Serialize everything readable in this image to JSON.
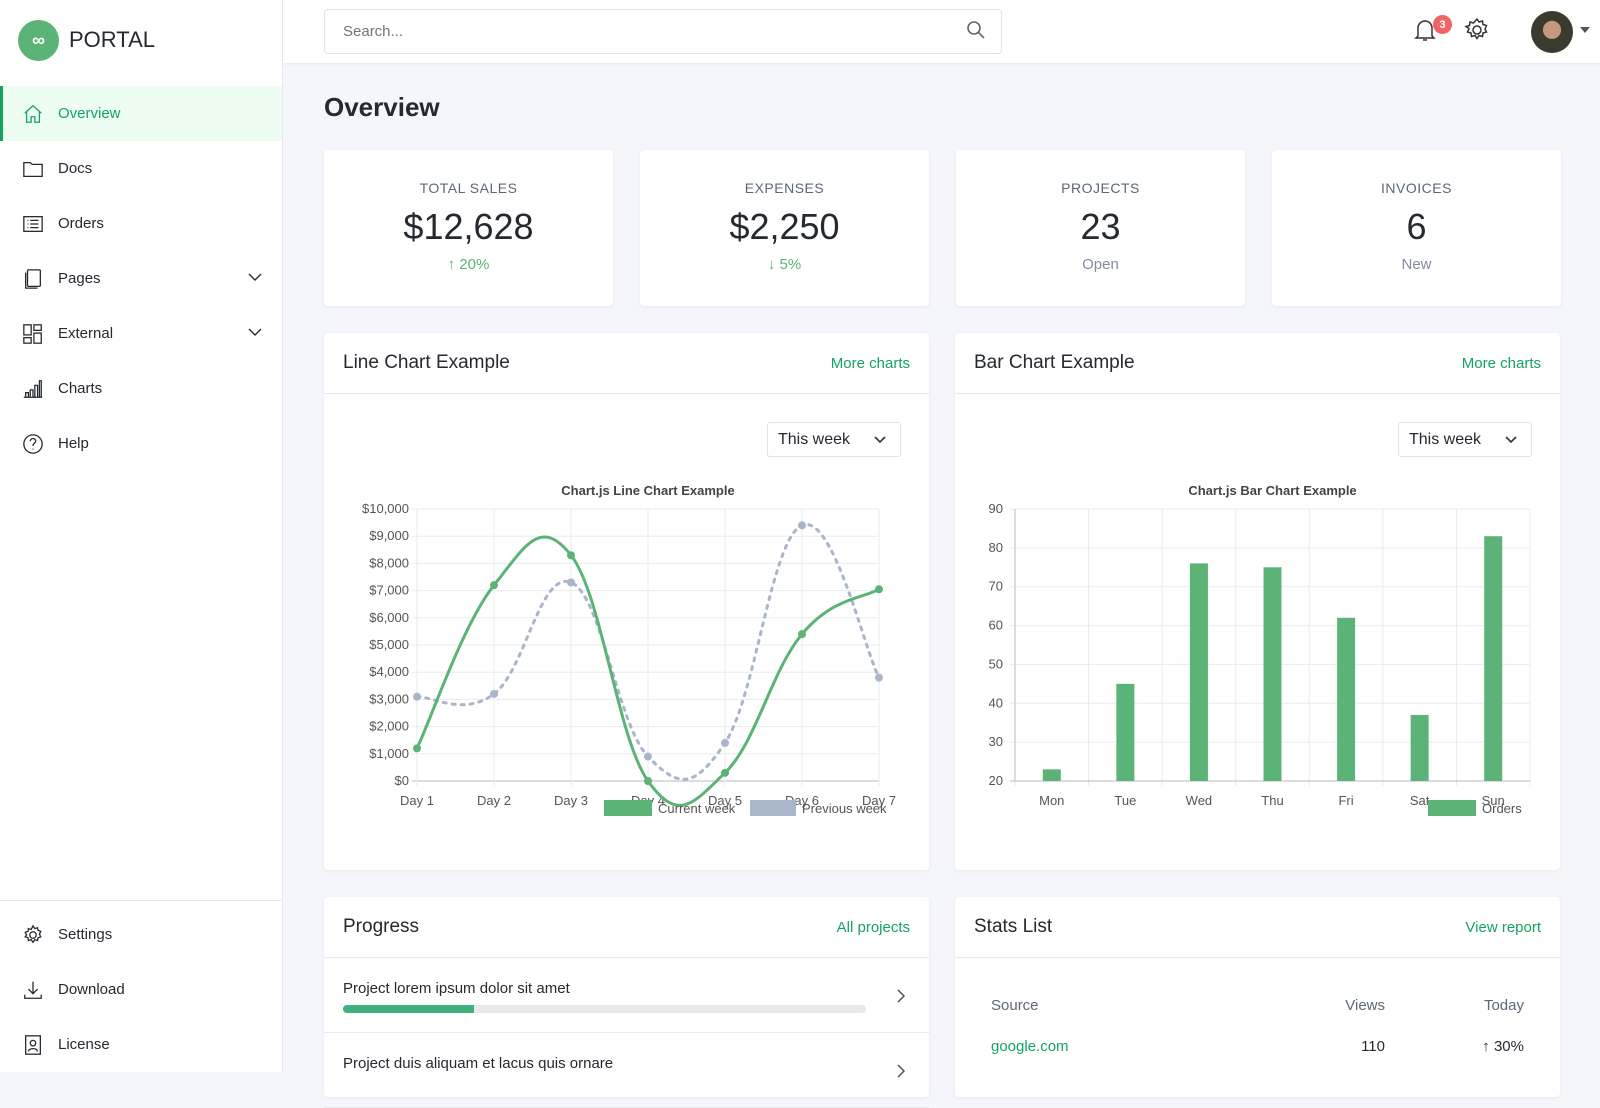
{
  "app": {
    "name": "PORTAL",
    "logo_glyph": "∞"
  },
  "sidebar": {
    "items": [
      {
        "label": "Overview",
        "icon": "home-icon",
        "active": true
      },
      {
        "label": "Docs",
        "icon": "folder-icon"
      },
      {
        "label": "Orders",
        "icon": "list-icon"
      },
      {
        "label": "Pages",
        "icon": "pages-icon",
        "expandable": true
      },
      {
        "label": "External",
        "icon": "grid-icon",
        "expandable": true
      },
      {
        "label": "Charts",
        "icon": "bar-chart-icon"
      },
      {
        "label": "Help",
        "icon": "help-icon"
      }
    ],
    "bottom": [
      {
        "label": "Settings",
        "icon": "gear-icon"
      },
      {
        "label": "Download",
        "icon": "download-icon"
      },
      {
        "label": "License",
        "icon": "license-icon"
      }
    ]
  },
  "header": {
    "search_placeholder": "Search...",
    "notifications": "3"
  },
  "page_title": "Overview",
  "stats": [
    {
      "label": "TOTAL SALES",
      "value": "$12,628",
      "sub": "↑ 20%",
      "trend": "up"
    },
    {
      "label": "EXPENSES",
      "value": "$2,250",
      "sub": "↓ 5%",
      "trend": "down"
    },
    {
      "label": "PROJECTS",
      "value": "23",
      "sub": "Open"
    },
    {
      "label": "INVOICES",
      "value": "6",
      "sub": "New"
    }
  ],
  "colors": {
    "accent": "#15a362",
    "current": "#5cb377",
    "previous": "#a9b5c9"
  },
  "line_card": {
    "title": "Line Chart Example",
    "link": "More charts",
    "select": "This week"
  },
  "bar_card": {
    "title": "Bar Chart Example",
    "link": "More charts",
    "select": "This week"
  },
  "chart_data": [
    {
      "type": "line",
      "title": "Chart.js Line Chart Example",
      "categories": [
        "Day 1",
        "Day 2",
        "Day 3",
        "Day 4",
        "Day 5",
        "Day 6",
        "Day 7"
      ],
      "yticks": [
        "$0",
        "$1,000",
        "$2,000",
        "$3,000",
        "$4,000",
        "$5,000",
        "$6,000",
        "$7,000",
        "$8,000",
        "$9,000",
        "$10,000"
      ],
      "ylim": [
        0,
        10000
      ],
      "grid": true,
      "legend": "bottom-right",
      "series": [
        {
          "name": "Current week",
          "values": [
            1200,
            7200,
            8300,
            0,
            300,
            5400,
            7050
          ],
          "style": "solid"
        },
        {
          "name": "Previous week",
          "values": [
            3100,
            3200,
            7300,
            900,
            1400,
            9400,
            3800
          ],
          "style": "dotted"
        }
      ]
    },
    {
      "type": "bar",
      "title": "Chart.js Bar Chart Example",
      "categories": [
        "Mon",
        "Tue",
        "Wed",
        "Thu",
        "Fri",
        "Sat",
        "Sun"
      ],
      "yticks": [
        "20",
        "30",
        "40",
        "50",
        "60",
        "70",
        "80",
        "90"
      ],
      "ylim": [
        20,
        90
      ],
      "grid": true,
      "legend": "bottom-right",
      "series": [
        {
          "name": "Orders",
          "values": [
            23,
            45,
            76,
            75,
            62,
            37,
            83
          ]
        }
      ]
    }
  ],
  "progress": {
    "title": "Progress",
    "link": "All projects",
    "items": [
      {
        "label": "Project lorem ipsum dolor sit amet",
        "percent": 25
      },
      {
        "label": "Project duis aliquam et lacus quis ornare",
        "percent": null
      }
    ]
  },
  "stats_list": {
    "title": "Stats List",
    "link": "View report",
    "columns": [
      "Source",
      "Views",
      "Today"
    ],
    "rows": [
      {
        "source": "google.com",
        "views": "110",
        "today": "↑ 30%"
      }
    ]
  }
}
